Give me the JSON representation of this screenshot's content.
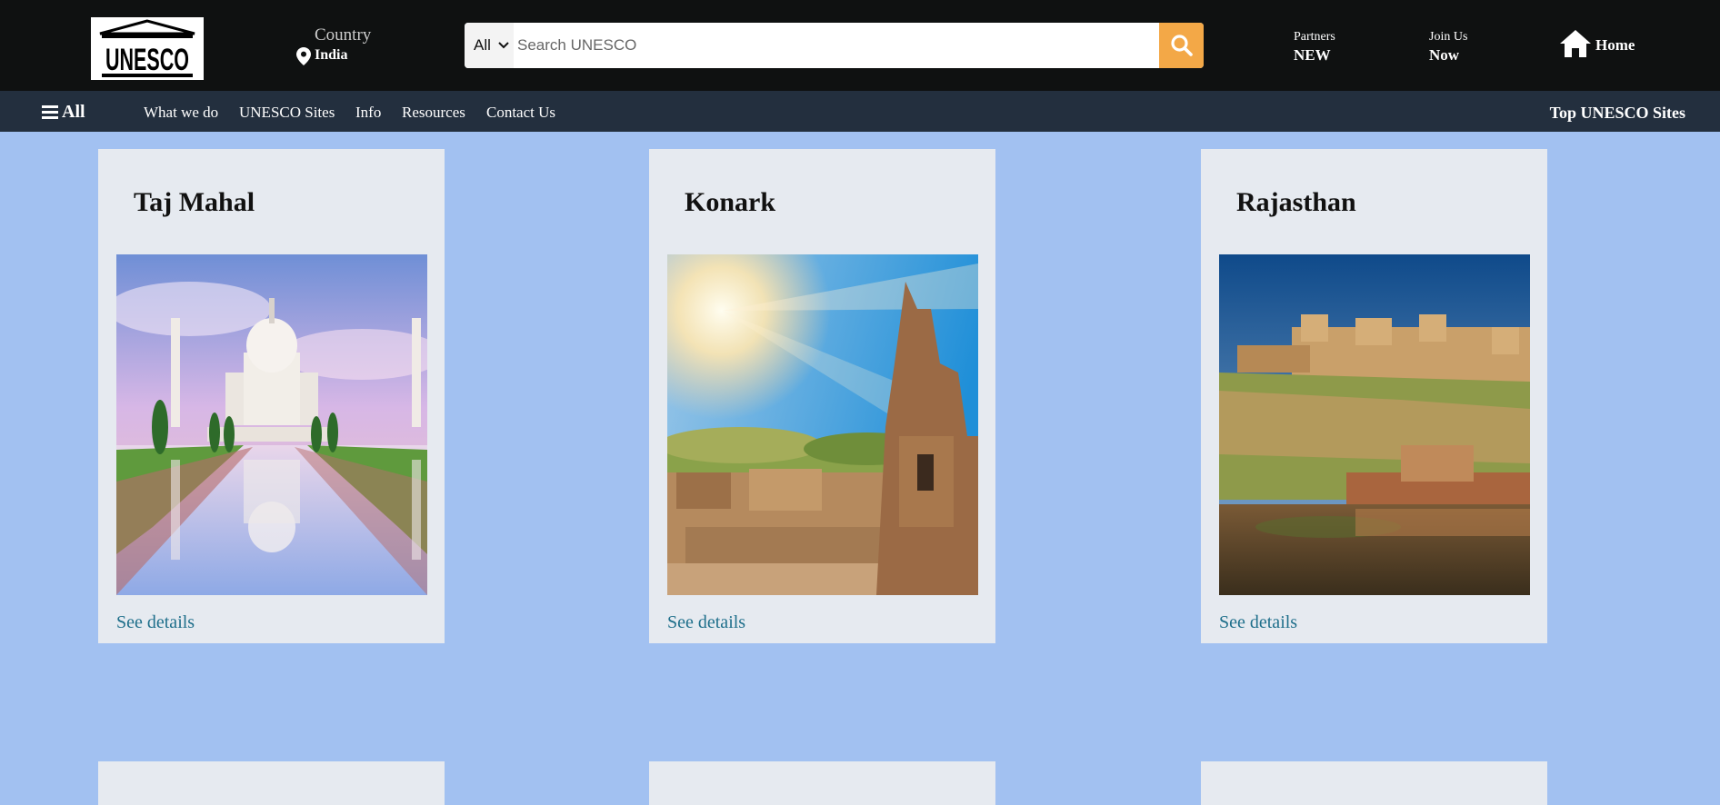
{
  "header": {
    "logo_text": "UNESCO",
    "country_label": "Country",
    "country_value": "India",
    "search_category": "All",
    "search_placeholder": "Search UNESCO",
    "partners_line1": "Partners",
    "partners_line2": "NEW",
    "join_line1": "Join Us",
    "join_line2": "Now",
    "home_label": "Home"
  },
  "subnav": {
    "all_label": "All",
    "items": [
      "What we do",
      "UNESCO Sites",
      "Info",
      "Resources",
      "Contact Us"
    ],
    "right_label": "Top UNESCO Sites"
  },
  "cards": [
    {
      "title": "Taj Mahal",
      "link": "See details",
      "image": "taj-mahal-photo"
    },
    {
      "title": "Konark",
      "link": "See details",
      "image": "konark-temple-photo"
    },
    {
      "title": "Rajasthan",
      "link": "See details",
      "image": "rajasthan-fort-photo"
    }
  ],
  "colors": {
    "header_bg": "#0f1111",
    "subnav_bg": "#232f3e",
    "page_bg": "#a2c1f1",
    "card_bg": "#e6eaf0",
    "search_button": "#f3a847",
    "link": "#1f6f8b"
  }
}
